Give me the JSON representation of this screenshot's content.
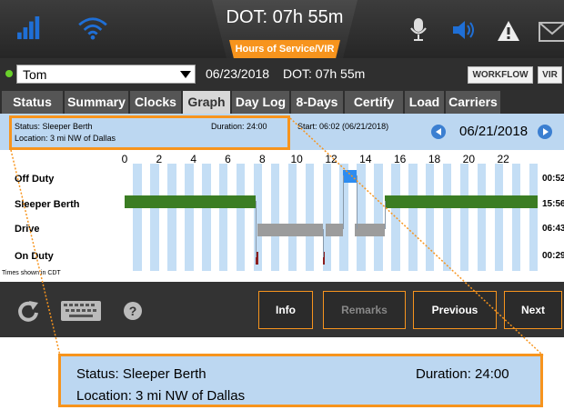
{
  "topbar": {
    "dot_title": "DOT: 07h 55m",
    "hos_button": "Hours of Service/VIR",
    "icons": [
      "signal-icon",
      "wifi-icon",
      "microphone-icon",
      "speaker-icon",
      "warning-icon",
      "mail-icon"
    ],
    "accent_color": "#f7941d",
    "icon_blue": "#1f6fd6"
  },
  "driver_row": {
    "driver": "Tom",
    "date": "06/23/2018",
    "dot": "DOT: 07h 55m",
    "workflow_label": "WORKFLOW",
    "vir_label": "VIR",
    "status_color": "#6ad12b"
  },
  "tabs": [
    {
      "label": "Status",
      "active": false
    },
    {
      "label": "Summary",
      "active": false
    },
    {
      "label": "Clocks",
      "active": false
    },
    {
      "label": "Graph",
      "active": true
    },
    {
      "label": "Day Log",
      "active": false
    },
    {
      "label": "8-Days",
      "active": false
    },
    {
      "label": "Certify",
      "active": false
    },
    {
      "label": "Load",
      "active": false
    },
    {
      "label": "Carriers",
      "active": false
    }
  ],
  "info": {
    "status": "Status: Sleeper Berth",
    "location": "Location: 3 mi NW of Dallas",
    "duration": "Duration: 24:00",
    "start": "Start: 06:02 (06/21/2018)",
    "nav_date": "06/21/2018"
  },
  "graph": {
    "hour_labels": [
      "0",
      "2",
      "4",
      "6",
      "8",
      "10",
      "12",
      "14",
      "16",
      "18",
      "20",
      "22"
    ],
    "rows": [
      {
        "label": "Off Duty",
        "total": "00:52"
      },
      {
        "label": "Sleeper Berth",
        "total": "15:56"
      },
      {
        "label": "Drive",
        "total": "06:43"
      },
      {
        "label": "On Duty",
        "total": "00:29"
      }
    ],
    "timezone_note": "Times shown in CDT",
    "segments": {
      "off_duty": [
        [
          12.7,
          13.5
        ]
      ],
      "sleeper": [
        [
          0,
          7.6
        ],
        [
          15.1,
          24
        ]
      ],
      "drive": [
        [
          7.7,
          11.5
        ],
        [
          11.7,
          12.7
        ],
        [
          13.4,
          15.1
        ]
      ],
      "on_duty_ticks": [
        7.6,
        11.5
      ]
    },
    "colors": {
      "stripe": "#c4def5",
      "off_duty": "#2d8cf0",
      "sleeper": "#3b7d23",
      "drive": "#9c9c9c",
      "on_duty": "#8b1e1e",
      "connector": "#8899aa"
    }
  },
  "bottom": {
    "refresh_icon": "refresh-icon",
    "keyboard_icon": "keyboard-icon",
    "help_icon": "help-icon",
    "info_label": "Info",
    "remarks_label": "Remarks",
    "previous_label": "Previous",
    "next_label": "Next"
  },
  "callout": {
    "status": "Status: Sleeper Berth",
    "location": "Location: 3 mi NW of Dallas",
    "duration": "Duration: 24:00"
  }
}
